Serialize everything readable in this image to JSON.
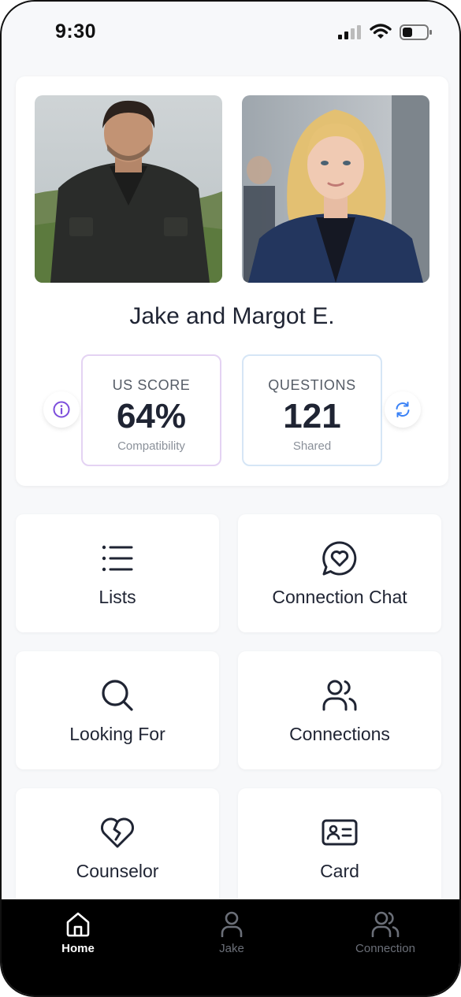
{
  "status_bar": {
    "time": "9:30"
  },
  "profile": {
    "name": "Jake and Margot E.",
    "us_score": {
      "title": "US SCORE",
      "value": "64%",
      "subtitle": "Compatibility"
    },
    "questions": {
      "title": "QUESTIONS",
      "value": "121",
      "subtitle": "Shared"
    },
    "info_icon": "info-icon",
    "refresh_icon": "refresh-icon"
  },
  "menu": [
    {
      "label": "Lists",
      "icon": "list-icon"
    },
    {
      "label": "Connection Chat",
      "icon": "chat-heart-icon"
    },
    {
      "label": "Looking For",
      "icon": "search-icon"
    },
    {
      "label": "Connections",
      "icon": "users-icon"
    },
    {
      "label": "Counselor",
      "icon": "broken-heart-icon"
    },
    {
      "label": "Card",
      "icon": "id-card-icon"
    }
  ],
  "tabs": [
    {
      "label": "Home",
      "icon": "home-icon",
      "active": true
    },
    {
      "label": "Jake",
      "icon": "user-icon",
      "active": false
    },
    {
      "label": "Connection",
      "icon": "users-icon",
      "active": false
    }
  ],
  "colors": {
    "score_border": "#e4d3f3",
    "questions_border": "#d6e6f6",
    "info_accent": "#7c4ddb",
    "refresh_accent": "#3b82f6",
    "tabbar_bg": "#000000"
  }
}
